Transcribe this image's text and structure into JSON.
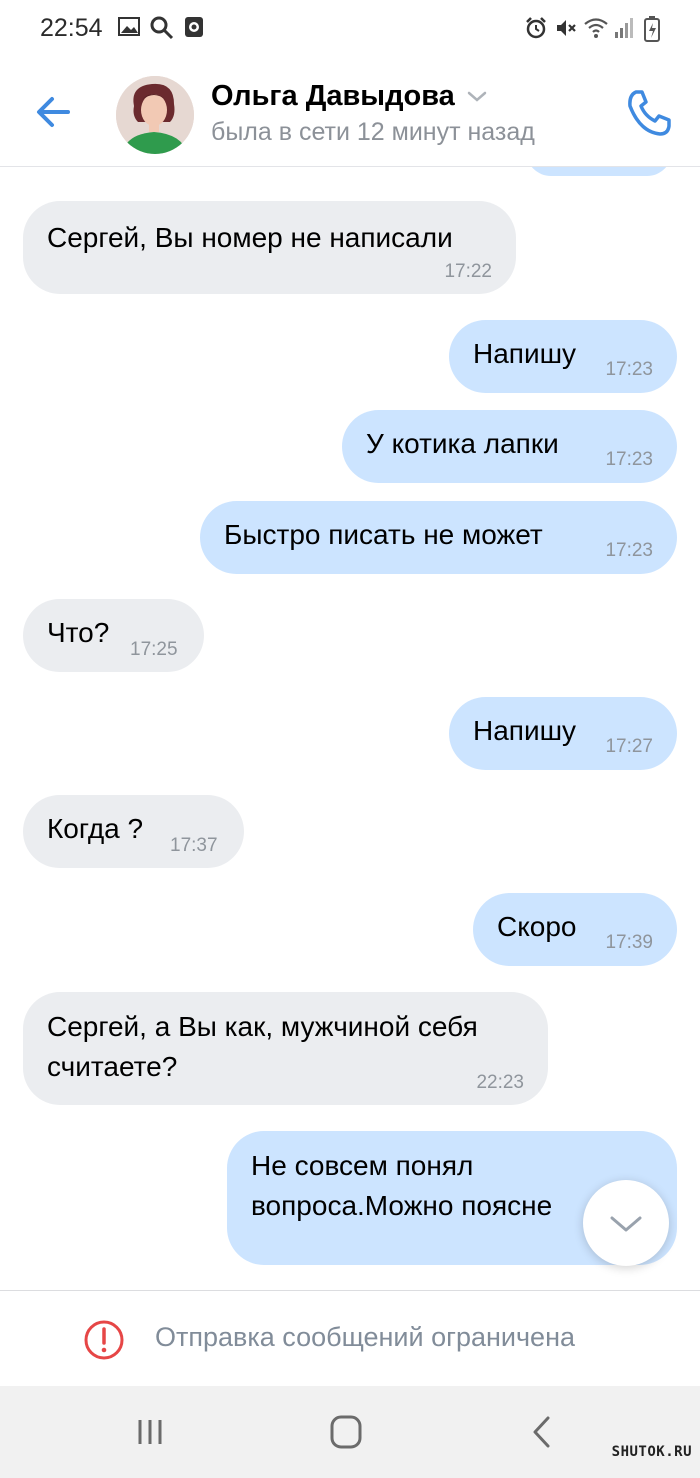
{
  "status_bar": {
    "time": "22:54",
    "left_icons": [
      "image-icon",
      "search-icon",
      "screen-record-icon"
    ],
    "right_icons": [
      "alarm-icon",
      "mute-icon",
      "wifi-icon",
      "signal-icon",
      "battery-icon"
    ]
  },
  "header": {
    "name": "Ольга Давыдова",
    "status": "была в сети 12 минут назад",
    "accent_color": "#3f8ae0"
  },
  "messages": [
    {
      "direction": "in",
      "text": [
        "Сергей, Вы номер не написали"
      ],
      "time": "17:22"
    },
    {
      "direction": "out",
      "text": [
        "Напишу"
      ],
      "time": "17:23"
    },
    {
      "direction": "out",
      "text": [
        "У котика лапки"
      ],
      "time": "17:23"
    },
    {
      "direction": "out",
      "text": [
        "Быстро писать не может"
      ],
      "time": "17:23"
    },
    {
      "direction": "in",
      "text": [
        "Что?"
      ],
      "time": "17:25"
    },
    {
      "direction": "out",
      "text": [
        "Напишу"
      ],
      "time": "17:27"
    },
    {
      "direction": "in",
      "text": [
        "Когда ?"
      ],
      "time": "17:37"
    },
    {
      "direction": "out",
      "text": [
        "Скоро"
      ],
      "time": "17:39"
    },
    {
      "direction": "in",
      "text": [
        "Сергей, а Вы как, мужчиной себя",
        "считаете?"
      ],
      "time": "22:23"
    },
    {
      "direction": "out",
      "text": [
        "Не совсем понял",
        "вопроса.Можно поясне"
      ],
      "time": ""
    }
  ],
  "restriction": {
    "text": "Отправка сообщений ограничена",
    "icon": "warning-circle-icon",
    "color": "#e64646"
  },
  "nav_bar": {
    "buttons": [
      "recent-apps-icon",
      "home-icon",
      "back-nav-icon"
    ]
  },
  "watermark": "SHUTOK.RU"
}
